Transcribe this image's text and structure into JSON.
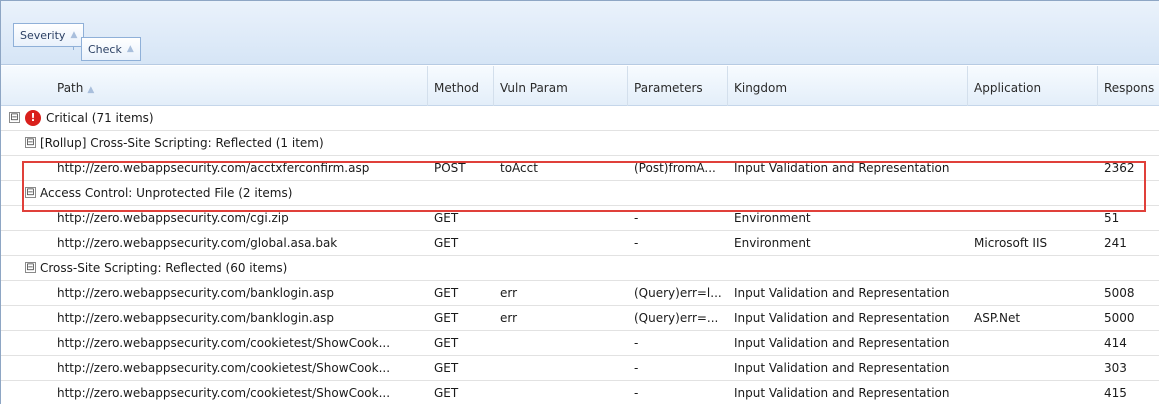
{
  "grouping": {
    "chips": [
      {
        "label": "Severity",
        "arrow": "▲"
      },
      {
        "label": "Check",
        "arrow": "▲"
      }
    ]
  },
  "columns": [
    {
      "label": "Path",
      "sort": "▲"
    },
    {
      "label": "Method",
      "sort": ""
    },
    {
      "label": "Vuln Param",
      "sort": ""
    },
    {
      "label": "Parameters",
      "sort": ""
    },
    {
      "label": "Kingdom",
      "sort": ""
    },
    {
      "label": "Application",
      "sort": ""
    },
    {
      "label": "Respons",
      "sort": ""
    }
  ],
  "severity_group": {
    "expander": "⊟",
    "icon": "!",
    "label": "Critical (71 items)"
  },
  "check_groups": [
    {
      "expander": "⊟",
      "label": "[Rollup] Cross-Site Scripting: Reflected (1 item)",
      "rows": [
        {
          "path": "http://zero.webappsecurity.com/acctxferconfirm.asp",
          "method": "POST",
          "vuln_param": "toAcct",
          "parameters": "(Post)fromA...",
          "kingdom": "Input Validation and Representation",
          "application": "",
          "response": "2362"
        }
      ]
    },
    {
      "expander": "⊟",
      "label": "Access Control: Unprotected File (2 items)",
      "rows": [
        {
          "path": "http://zero.webappsecurity.com/cgi.zip",
          "method": "GET",
          "vuln_param": "",
          "parameters": "-",
          "kingdom": "Environment",
          "application": "",
          "response": "51"
        },
        {
          "path": "http://zero.webappsecurity.com/global.asa.bak",
          "method": "GET",
          "vuln_param": "",
          "parameters": "-",
          "kingdom": "Environment",
          "application": "Microsoft IIS",
          "response": "241"
        }
      ]
    },
    {
      "expander": "⊟",
      "label": "Cross-Site Scripting: Reflected (60 items)",
      "rows": [
        {
          "path": "http://zero.webappsecurity.com/banklogin.asp",
          "method": "GET",
          "vuln_param": "err",
          "parameters": "(Query)err=l...",
          "kingdom": "Input Validation and Representation",
          "application": "",
          "response": "5008"
        },
        {
          "path": "http://zero.webappsecurity.com/banklogin.asp",
          "method": "GET",
          "vuln_param": "err",
          "parameters": "(Query)err=...",
          "kingdom": "Input Validation and Representation",
          "application": "ASP.Net",
          "response": "5000"
        },
        {
          "path": "http://zero.webappsecurity.com/cookietest/ShowCook...",
          "method": "GET",
          "vuln_param": "",
          "parameters": "-",
          "kingdom": "Input Validation and Representation",
          "application": "",
          "response": "414"
        },
        {
          "path": "http://zero.webappsecurity.com/cookietest/ShowCook...",
          "method": "GET",
          "vuln_param": "",
          "parameters": "-",
          "kingdom": "Input Validation and Representation",
          "application": "",
          "response": "303"
        },
        {
          "path": "http://zero.webappsecurity.com/cookietest/ShowCook...",
          "method": "GET",
          "vuln_param": "",
          "parameters": "-",
          "kingdom": "Input Validation and Representation",
          "application": "",
          "response": "415"
        }
      ]
    }
  ],
  "colors": {
    "highlight": "#e0403a",
    "critical_icon": "#d9201c",
    "group_bar": "#d6e5f6"
  }
}
